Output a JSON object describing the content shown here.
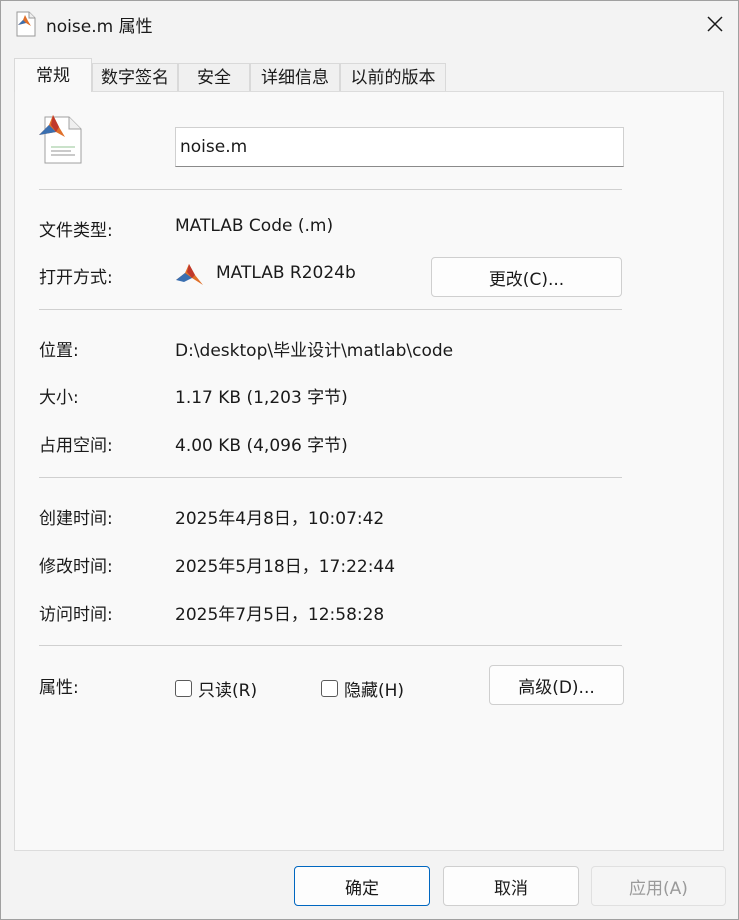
{
  "window": {
    "title": "noise.m 属性",
    "close_glyph": "✕"
  },
  "tabs": [
    {
      "label": "常规",
      "active": true
    },
    {
      "label": "数字签名"
    },
    {
      "label": "安全"
    },
    {
      "label": "详细信息"
    },
    {
      "label": "以前的版本"
    }
  ],
  "general": {
    "file_name": "noise.m",
    "file_type_label": "文件类型:",
    "file_type_value": "MATLAB Code (.m)",
    "open_with_label": "打开方式:",
    "open_with_value": "MATLAB R2024b",
    "change_button": "更改(C)...",
    "location_label": "位置:",
    "location_value": "D:\\desktop\\毕业设计\\matlab\\code",
    "size_label": "大小:",
    "size_value": "1.17 KB (1,203 字节)",
    "disk_size_label": "占用空间:",
    "disk_size_value": "4.00 KB (4,096 字节)",
    "created_label": "创建时间:",
    "created_value": "2025年4月8日，10:07:42",
    "modified_label": "修改时间:",
    "modified_value": "2025年5月18日，17:22:44",
    "accessed_label": "访问时间:",
    "accessed_value": "2025年7月5日，12:58:28",
    "attributes_label": "属性:",
    "readonly_label": "只读(R)",
    "hidden_label": "隐藏(H)",
    "advanced_button": "高级(D)..."
  },
  "footer": {
    "ok_button": "确定",
    "cancel_button": "取消",
    "apply_button": "应用(A)"
  },
  "colors": {
    "accent": "#0067c0",
    "panel": "#f9f9f9",
    "window": "#f3f3f3"
  }
}
